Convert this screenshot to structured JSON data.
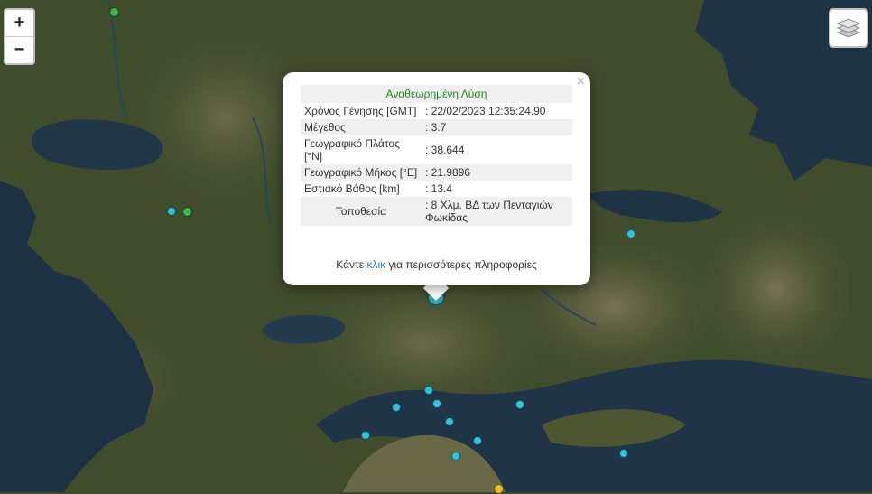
{
  "map": {
    "zoom_in_label": "+",
    "zoom_out_label": "−",
    "layers_icon": "layers-icon",
    "colors": {
      "marker_cyan": "#37c0d6",
      "marker_green": "#3fb34f",
      "marker_yellow": "#e8c02a",
      "header_green": "#1e8a1e",
      "link_blue": "#2a7fbf"
    }
  },
  "popup": {
    "close_label": "×",
    "header": "Αναθεωρημένη Λύση",
    "rows": [
      {
        "label": "Χρόνος Γένησης [GMT]",
        "value": ": 22/02/2023 12:35:24.90"
      },
      {
        "label": "Μέγεθος",
        "value": ": 3.7"
      },
      {
        "label": "Γεωγραφικό Πλάτος [°N]",
        "value": ": 38.644"
      },
      {
        "label": "Γεωγραφικό Μήκος [°E]",
        "value": ": 21.9896"
      },
      {
        "label": "Εστιακό Βάθος [km]",
        "value": ": 13.4"
      },
      {
        "label": "Τοποθεσία",
        "value": ": 8 Χλμ. ΒΔ των Πενταγιών Φωκίδας"
      }
    ],
    "more_prefix": "Κάντε ",
    "more_link": "κλικ",
    "more_suffix": " για περισσότερες πληροφορίες"
  }
}
